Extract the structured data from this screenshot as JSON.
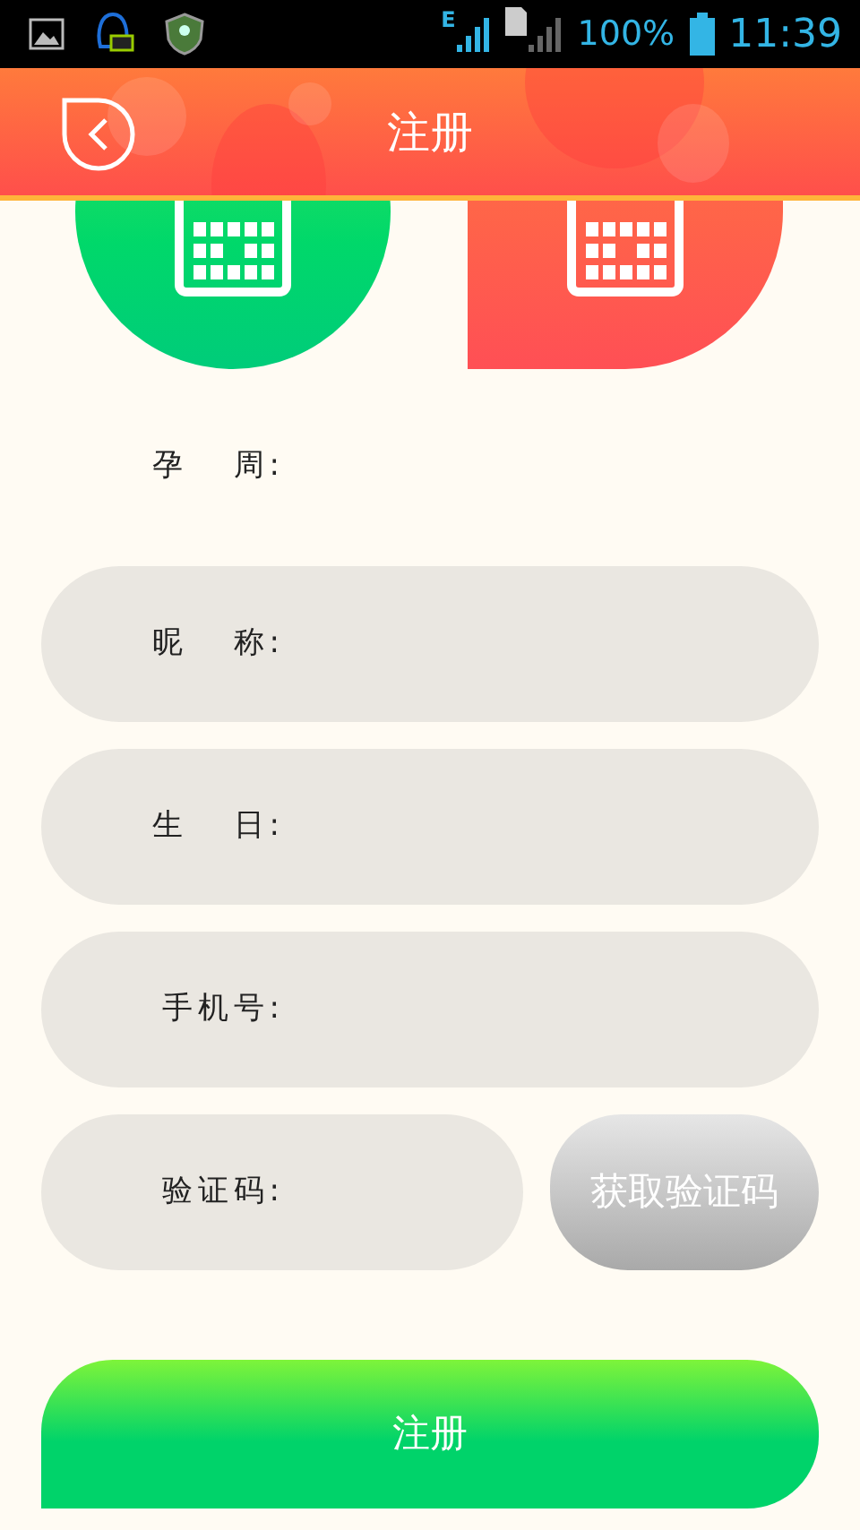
{
  "status_bar": {
    "network": "E",
    "battery": "100%",
    "time": "11:39"
  },
  "header": {
    "title": "注册"
  },
  "fields": [
    {
      "label": "孕 周:",
      "kind": "plain"
    },
    {
      "label": "昵 称:",
      "kind": "input"
    },
    {
      "label": "生 日:",
      "kind": "input"
    },
    {
      "label": "手机号:",
      "kind": "input"
    },
    {
      "label": "验证码:",
      "kind": "code",
      "button": "获取验证码"
    }
  ],
  "submit": "注册"
}
